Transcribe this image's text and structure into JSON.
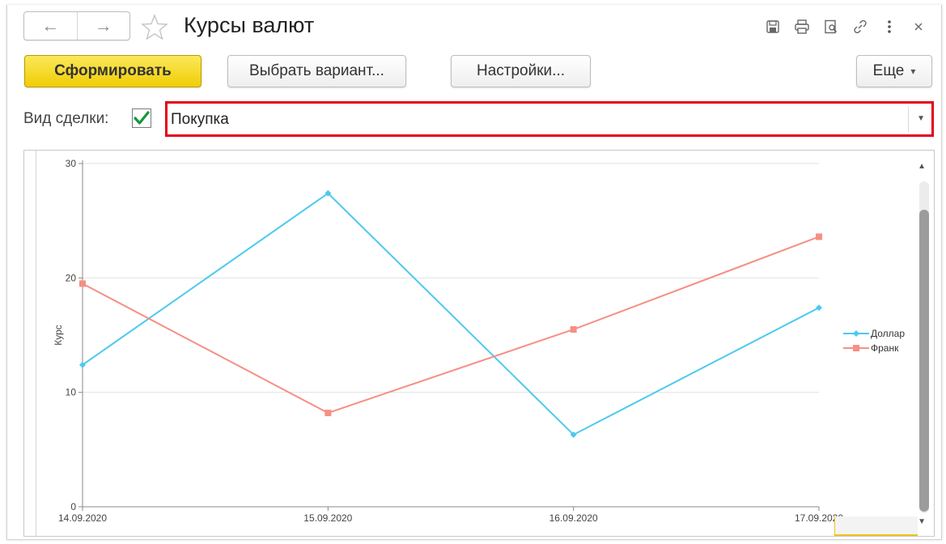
{
  "window": {
    "title": "Курсы валют"
  },
  "nav": {
    "back_label": "←",
    "forward_label": "→"
  },
  "toolbar": {
    "generate_label": "Сформировать",
    "choose_variant_label": "Выбрать вариант...",
    "settings_label": "Настройки...",
    "more_label": "Еще"
  },
  "deal": {
    "label": "Вид сделки:",
    "checked": true,
    "value": "Покупка"
  },
  "icons": {
    "title_bar": [
      "save-icon",
      "print-icon",
      "preview-icon",
      "link-icon",
      "more-vertical-icon",
      "close-icon"
    ]
  },
  "colors": {
    "accent_yellow": "#f5d50b",
    "highlight_red": "#e3001b",
    "dollar": "#4dc9f0",
    "frank": "#f68f84"
  },
  "chart_data": {
    "type": "line",
    "x": [
      "14.09.2020",
      "15.09.2020",
      "16.09.2020",
      "17.09.2020"
    ],
    "series": [
      {
        "name": "Доллар",
        "color": "#4dc9f0",
        "marker": "diamond",
        "values": [
          12.4,
          27.4,
          6.3,
          17.4
        ]
      },
      {
        "name": "Франк",
        "color": "#f68f84",
        "marker": "square",
        "values": [
          19.5,
          8.2,
          15.5,
          23.6
        ]
      }
    ],
    "ylabel": "Курс",
    "ylim": [
      0,
      30
    ],
    "yticks": [
      0,
      10,
      20,
      30
    ],
    "grid": true,
    "legend": "right"
  }
}
